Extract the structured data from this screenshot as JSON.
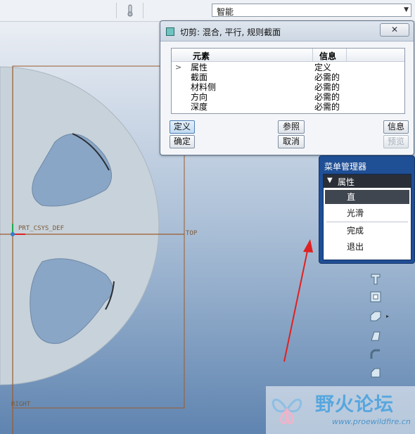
{
  "toolbar": {
    "thermometer_icon": "thermometer-icon",
    "filter_value": "智能"
  },
  "canvas": {
    "csys_label": "PRT_CSYS_DEF",
    "top_label": "TOP",
    "right_label": "RIGHT",
    "colors": {
      "part": "#c8d2da",
      "datum": "#9a5c2d",
      "arrow": "#e02020"
    }
  },
  "dialog": {
    "title": "切剪: 混合, 平行, 规则截面",
    "close_label": "关闭",
    "columns": {
      "element": "元素",
      "info": "信息"
    },
    "rows": [
      {
        "marker": ">",
        "element": "属性",
        "info": "定义"
      },
      {
        "marker": "",
        "element": "截面",
        "info": "必需的"
      },
      {
        "marker": "",
        "element": "材料侧",
        "info": "必需的"
      },
      {
        "marker": "",
        "element": "方向",
        "info": "必需的"
      },
      {
        "marker": "",
        "element": "深度",
        "info": "必需的"
      }
    ],
    "buttons": {
      "define": "定义",
      "reference": "参照",
      "info": "信息",
      "ok": "确定",
      "cancel": "取消",
      "preview": "预览"
    }
  },
  "menu_manager": {
    "title": "菜单管理器",
    "section": "属性",
    "items": [
      "直",
      "光滑",
      "完成",
      "退出"
    ],
    "selected_index": 0
  },
  "watermark": {
    "name": "野火论坛",
    "url": "www.proewildfire.cn"
  }
}
